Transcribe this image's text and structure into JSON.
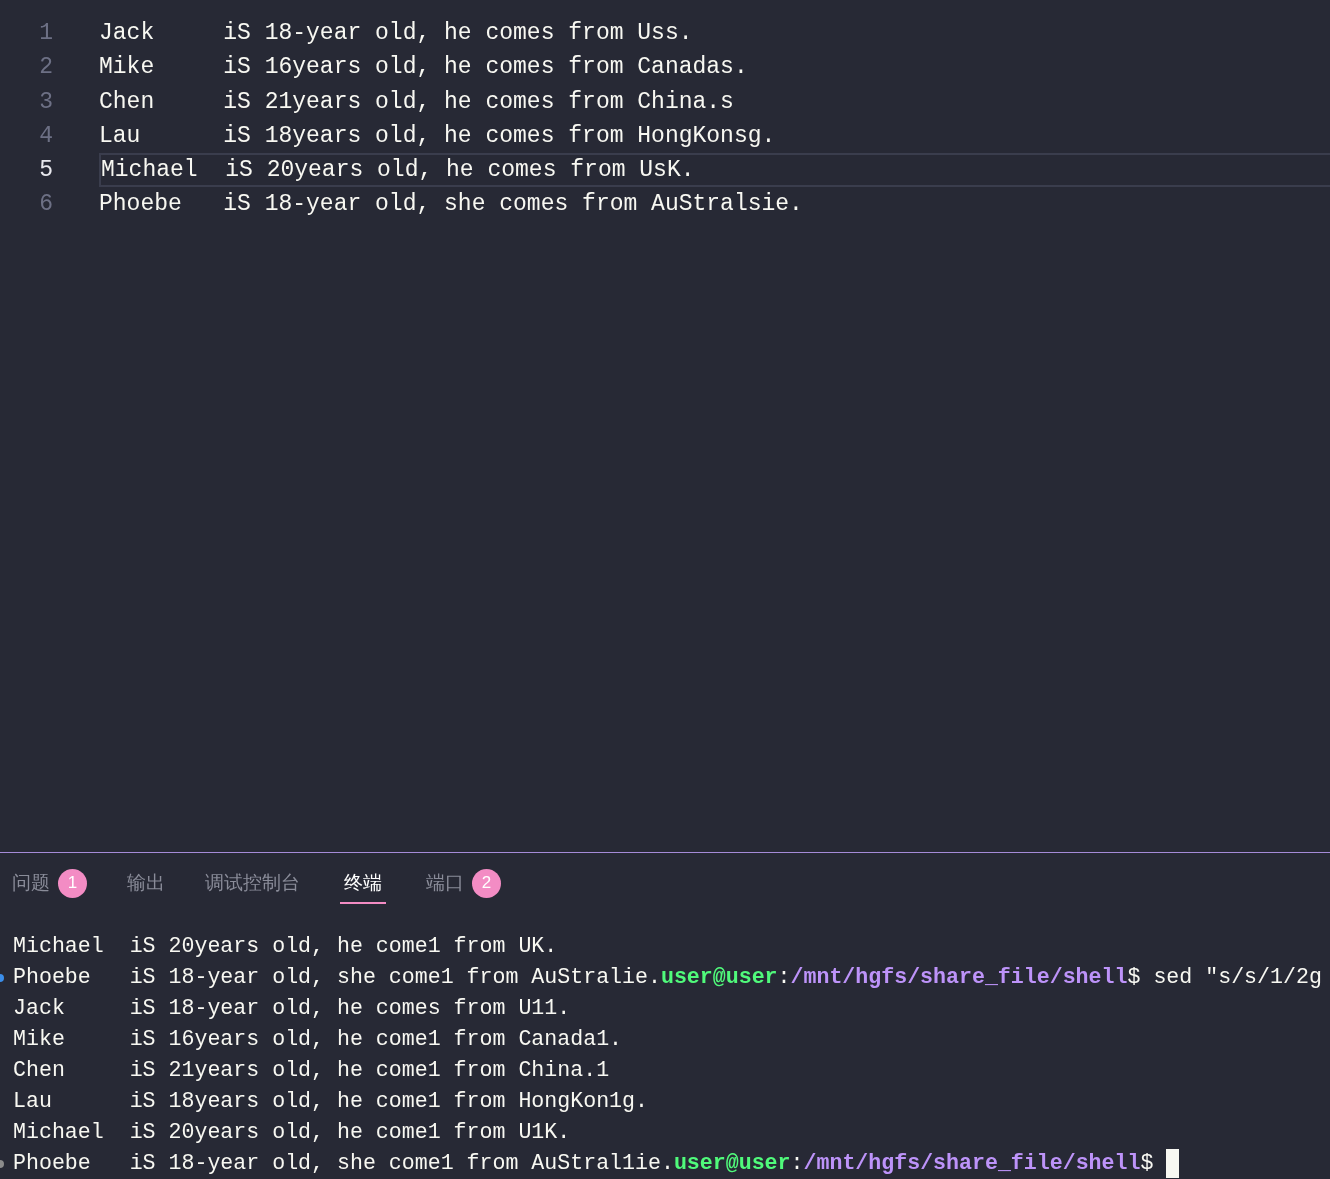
{
  "editor": {
    "lines": [
      {
        "number": "1",
        "text": "Jack     iS 18-year old, he comes from Uss.",
        "selected": false
      },
      {
        "number": "2",
        "text": "Mike     iS 16years old, he comes from Canadas.",
        "selected": false
      },
      {
        "number": "3",
        "text": "Chen     iS 21years old, he comes from China.s",
        "selected": false
      },
      {
        "number": "4",
        "text": "Lau      iS 18years old, he comes from HongKonsg.",
        "selected": false
      },
      {
        "number": "5",
        "text": "Michael  iS 20years old, he comes from UsK.",
        "selected": true
      },
      {
        "number": "6",
        "text": "Phoebe   iS 18-year old, she comes from AuStralsie.",
        "selected": false
      }
    ]
  },
  "panel": {
    "tabs": [
      {
        "label": "问题",
        "badge": "1",
        "selected": false
      },
      {
        "label": "输出",
        "selected": false
      },
      {
        "label": "调试控制台",
        "selected": false
      },
      {
        "label": "终端",
        "selected": true
      },
      {
        "label": "端口",
        "badge": "2",
        "selected": false
      }
    ],
    "terminal": [
      {
        "text": "Michael  iS 20years old, he come1 from UK."
      },
      {
        "text": "Phoebe   iS 18-year old, she come1 from AuStralie.",
        "color": "#3b8eea",
        "prompt": {
          "user": "user@user",
          "sep": ":",
          "path": "/mnt/hgfs/share_file/shell",
          "dollar": "$",
          "command": " sed \"s/s/1/2g"
        }
      },
      {
        "text": "Jack     iS 18-year old, he comes from U11."
      },
      {
        "text": "Mike     iS 16years old, he come1 from Canada1."
      },
      {
        "text": "Chen     iS 21years old, he come1 from China.1"
      },
      {
        "text": "Lau      iS 18years old, he come1 from HongKon1g."
      },
      {
        "text": "Michael  iS 20years old, he come1 from U1K."
      },
      {
        "text": "Phoebe   iS 18-year old, she come1 from AuStral1ie.",
        "color": "#8b8b8b",
        "prompt": {
          "user": "user@user",
          "sep": ":",
          "path": "/mnt/hgfs/share_file/shell",
          "dollar": "$"
        },
        "cursor": true
      }
    ]
  }
}
